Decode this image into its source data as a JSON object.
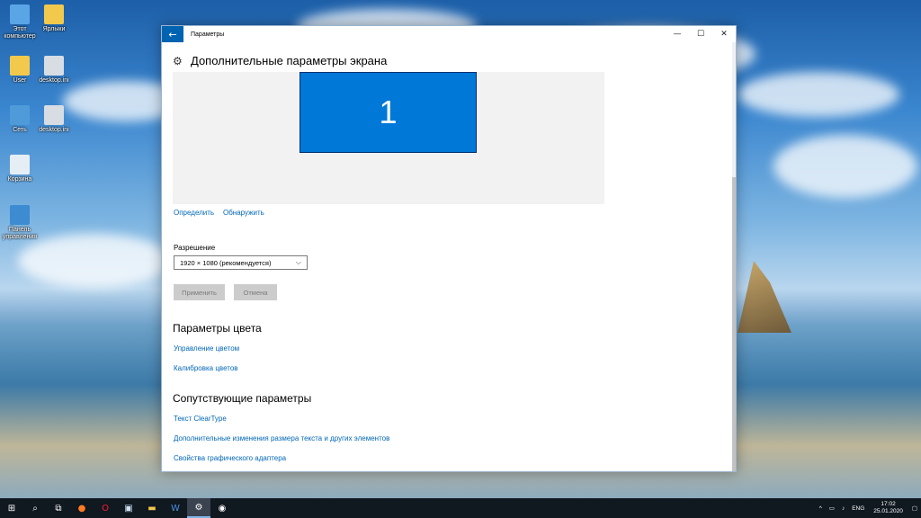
{
  "desktop": {
    "icons": [
      {
        "label": "Этот компьютер",
        "icon": "computer-icon"
      },
      {
        "label": "Ярлыки",
        "icon": "folder-icon"
      },
      {
        "label": "User",
        "icon": "user-folder-icon"
      },
      {
        "label": "desktop.ini",
        "icon": "ini-file-icon"
      },
      {
        "label": "Сеть",
        "icon": "network-icon"
      },
      {
        "label": "desktop.ini",
        "icon": "ini-file-icon"
      },
      {
        "label": "Корзина",
        "icon": "recycle-bin-icon"
      },
      {
        "label": "Панель управления",
        "icon": "control-panel-icon"
      }
    ]
  },
  "window": {
    "title": "Параметры",
    "back_icon": "back-arrow-icon",
    "controls": {
      "minimize": "—",
      "maximize": "☐",
      "close": "✕"
    }
  },
  "page": {
    "title": "Дополнительные параметры экрана",
    "gear_icon": "gear-icon",
    "monitor_number": "1",
    "identify_link": "Определить",
    "detect_link": "Обнаружить",
    "resolution_label": "Разрешение",
    "resolution_value": "1920 × 1080 (рекомендуется)",
    "apply_button": "Применить",
    "cancel_button": "Отмена",
    "color_section": {
      "title": "Параметры цвета",
      "links": [
        "Управление цветом",
        "Калибровка цветов"
      ]
    },
    "related_section": {
      "title": "Сопутствующие параметры",
      "links": [
        "Текст ClearType",
        "Дополнительные изменения размера текста и других элементов",
        "Свойства графического адаптера"
      ]
    }
  },
  "taskbar": {
    "items": [
      "start-icon",
      "search-icon",
      "task-view-icon",
      "firefox-icon",
      "opera-icon",
      "store-icon",
      "explorer-icon",
      "word-icon",
      "settings-icon",
      "app-icon"
    ],
    "language": "ENG",
    "time": "17:02",
    "date": "25.01.2020"
  },
  "colors": {
    "accent": "#0078d7",
    "link": "#0067b8",
    "taskbar": "#101820"
  }
}
